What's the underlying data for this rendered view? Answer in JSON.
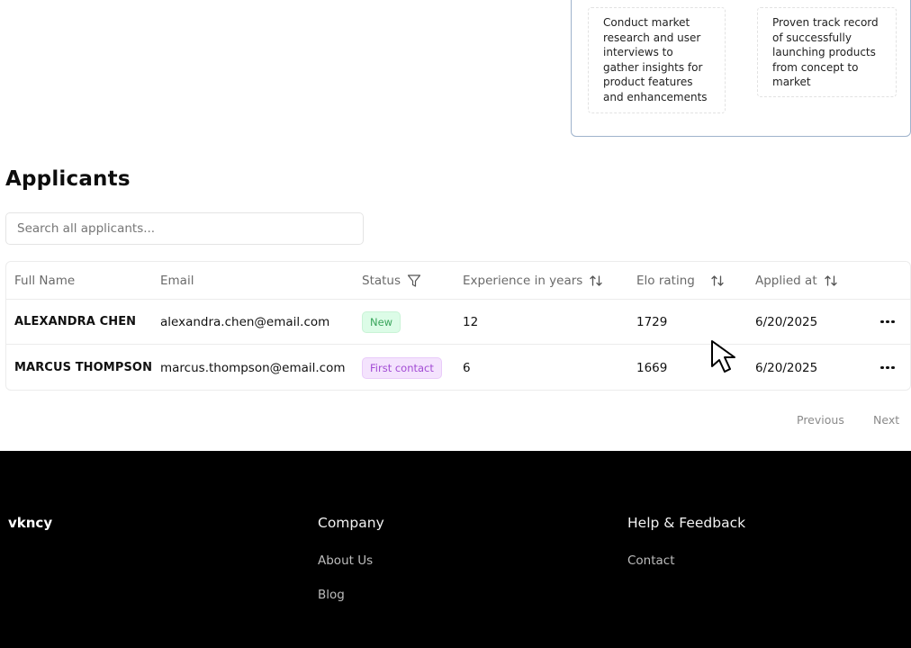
{
  "job_card": {
    "requirements": [
      {
        "text": "Conduct market research and user interviews to gather insights for product features and enhancements"
      },
      {
        "text": "Proven track record of successfully launching products from concept to market"
      }
    ]
  },
  "applicants": {
    "title": "Applicants",
    "search_placeholder": "Search all applicants...",
    "columns": {
      "full_name": "Full Name",
      "email": "Email",
      "status": "Status",
      "experience": "Experience in years",
      "elo": "Elo rating",
      "applied": "Applied at"
    },
    "rows": [
      {
        "name": "ALEXANDRA CHEN",
        "email": "alexandra.chen@email.com",
        "status": "New",
        "experience": "12",
        "elo": "1729",
        "applied": "6/20/2025"
      },
      {
        "name": "MARCUS THOMPSON",
        "email": "marcus.thompson@email.com",
        "status": "First contact",
        "experience": "6",
        "elo": "1669",
        "applied": "6/20/2025"
      }
    ],
    "pagination": {
      "previous": "Previous",
      "next": "Next"
    }
  },
  "icons": {
    "filter": "filter-icon",
    "sort": "sort-arrows-icon",
    "more": "more-horizontal-icon",
    "cursor": "mouse-pointer-icon"
  },
  "colors": {
    "status_new_bg": "#dcfce7",
    "status_new_text": "#3aa55c",
    "status_contact_bg": "#f4e3fd",
    "status_contact_text": "#a24bd4",
    "footer_bg": "#000000"
  },
  "footer": {
    "brand": "vkncy",
    "company": {
      "title": "Company",
      "links": [
        "About Us",
        "Blog"
      ]
    },
    "help": {
      "title": "Help & Feedback",
      "links": [
        "Contact"
      ]
    }
  }
}
